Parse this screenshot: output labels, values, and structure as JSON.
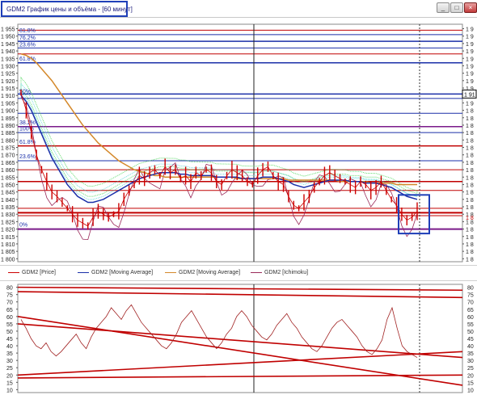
{
  "window": {
    "title": "GDM2 График цены и объёма - [60 минут]",
    "buttons": [
      "_",
      "□",
      "×"
    ]
  },
  "colors": {
    "price": "#cc0000",
    "ma_fast": "#1a2fa8",
    "ma_slow": "#d4882a",
    "ichimoku": "#9a2a5a",
    "cloud": "#22cc33",
    "cloud_cyan": "#33cccc",
    "fib_line": "#1a2fa8",
    "red_level": "#c00000",
    "purple_level": "#7a1a8a",
    "accent_box": "#1f3fb8"
  },
  "price_axis": {
    "ticks": [
      "1 955",
      "1 950",
      "1 945",
      "1 940",
      "1 935",
      "1 930",
      "1 925",
      "1 920",
      "1 915",
      "1 910",
      "1 905",
      "1 900",
      "1 895",
      "1 890",
      "1 885",
      "1 880",
      "1 875",
      "1 870",
      "1 865",
      "1 860",
      "1 855",
      "1 850",
      "1 845",
      "1 840",
      "1 835",
      "1 830",
      "1 825",
      "1 820",
      "1 815",
      "1 810",
      "1 805",
      "1 800"
    ],
    "right_ticks": [
      "1 9",
      "1 9",
      "1 9",
      "1 9",
      "1 9",
      "1 9",
      "1 9",
      "1 9",
      "1 9",
      "1 9",
      "1 9",
      "1 8",
      "1 8",
      "1 8",
      "1 8",
      "1 8",
      "1 8",
      "1 8",
      "1 8",
      "1 8",
      "1 8",
      "1 8",
      "1 8",
      "1 8",
      "1 8",
      "1 8",
      "1 8",
      "1 8",
      "1 8",
      "1 8",
      "1 8",
      "1 8"
    ],
    "current_value": "1 91",
    "current_value_red": "1 8"
  },
  "fib_labels": [
    "81.8%",
    "76.2%",
    "23.6%",
    "61.8%",
    "50%",
    "38.2%",
    "100%",
    "61.8%",
    "23.6%",
    "0%"
  ],
  "legend": [
    {
      "label": "GDM2 [Price]",
      "color": "#cc0000"
    },
    {
      "label": "GDM2 [Moving Average]",
      "color": "#1a2fa8"
    },
    {
      "label": "GDM2 [Moving Average]",
      "color": "#d4882a"
    },
    {
      "label": "GDM2 [Ichimoku]",
      "color": "#9a2a5a"
    }
  ],
  "osc_axis": {
    "ticks": [
      "80",
      "75",
      "70",
      "65",
      "60",
      "55",
      "50",
      "45",
      "40",
      "35",
      "30",
      "25",
      "20",
      "15",
      "10"
    ]
  },
  "chart_data": [
    {
      "type": "line",
      "title": "",
      "series": [
        {
          "name": "GDM2 [Price]",
          "values": [
            1912,
            1900,
            1885,
            1870,
            1860,
            1852,
            1845,
            1842,
            1838,
            1834,
            1830,
            1826,
            1824,
            1822,
            1828,
            1832,
            1830,
            1828,
            1830,
            1832,
            1840,
            1846,
            1850,
            1856,
            1854,
            1858,
            1860,
            1856,
            1862,
            1858,
            1860,
            1854,
            1856,
            1852,
            1858,
            1856,
            1860,
            1858,
            1852,
            1850,
            1856,
            1860,
            1858,
            1856,
            1852,
            1850,
            1856,
            1860,
            1862,
            1856,
            1852,
            1850,
            1842,
            1836,
            1834,
            1838,
            1842,
            1848,
            1852,
            1856,
            1858,
            1856,
            1854,
            1852,
            1850,
            1848,
            1852,
            1850,
            1846,
            1848,
            1852,
            1846,
            1840,
            1836,
            1830,
            1826,
            1828,
            1832
          ]
        },
        {
          "name": "GDM2 [Moving Average]",
          "values": [
            1910,
            1906,
            1900,
            1892,
            1884,
            1876,
            1868,
            1862,
            1856,
            1850,
            1846,
            1842,
            1840,
            1838,
            1838,
            1839,
            1840,
            1842,
            1844,
            1846,
            1848,
            1850,
            1852,
            1854,
            1855,
            1856,
            1857,
            1858,
            1858,
            1858,
            1858,
            1857,
            1857,
            1856,
            1856,
            1856,
            1856,
            1856,
            1855,
            1855,
            1855,
            1855,
            1855,
            1854,
            1854,
            1854,
            1854,
            1855,
            1855,
            1855,
            1854,
            1853,
            1852,
            1850,
            1849,
            1848,
            1849,
            1850,
            1851,
            1852,
            1853,
            1853,
            1853,
            1853,
            1852,
            1852,
            1852,
            1851,
            1851,
            1851,
            1850,
            1849,
            1848,
            1846,
            1844,
            1842,
            1841,
            1840
          ]
        },
        {
          "name": "GDM2 [Moving Average]",
          "values": [
            1938,
            1937,
            1935,
            1932,
            1928,
            1924,
            1920,
            1915,
            1910,
            1905,
            1900,
            1895,
            1890,
            1886,
            1882,
            1878,
            1875,
            1872,
            1869,
            1866,
            1864,
            1862,
            1860,
            1859,
            1858,
            1857,
            1856,
            1856,
            1855,
            1855,
            1855,
            1855,
            1855,
            1855,
            1855,
            1855,
            1855,
            1855,
            1855,
            1855,
            1855,
            1855,
            1854,
            1854,
            1854,
            1854,
            1854,
            1854,
            1854,
            1854,
            1854,
            1854,
            1853,
            1853,
            1853,
            1853,
            1853,
            1853,
            1853,
            1853,
            1853,
            1853,
            1852,
            1852,
            1852,
            1852,
            1852,
            1852,
            1851,
            1851,
            1851,
            1851,
            1851,
            1850,
            1850,
            1850,
            1850,
            1850
          ]
        }
      ],
      "ylim": [
        1798,
        1958
      ]
    },
    {
      "type": "line",
      "title": "",
      "series": [
        {
          "name": "",
          "values": [
            58,
            52,
            45,
            40,
            38,
            42,
            36,
            33,
            36,
            40,
            44,
            48,
            42,
            38,
            46,
            52,
            56,
            60,
            66,
            62,
            58,
            64,
            68,
            62,
            56,
            52,
            48,
            44,
            40,
            38,
            42,
            48,
            56,
            60,
            64,
            58,
            52,
            46,
            42,
            38,
            42,
            48,
            52,
            60,
            64,
            60,
            54,
            50,
            46,
            44,
            48,
            54,
            58,
            62,
            56,
            52,
            46,
            42,
            38,
            36,
            40,
            46,
            52,
            56,
            58,
            54,
            50,
            46,
            40,
            36,
            34,
            38,
            44,
            58,
            66,
            52,
            40,
            36,
            34,
            32
          ]
        }
      ],
      "ylim": [
        8,
        82
      ]
    }
  ]
}
